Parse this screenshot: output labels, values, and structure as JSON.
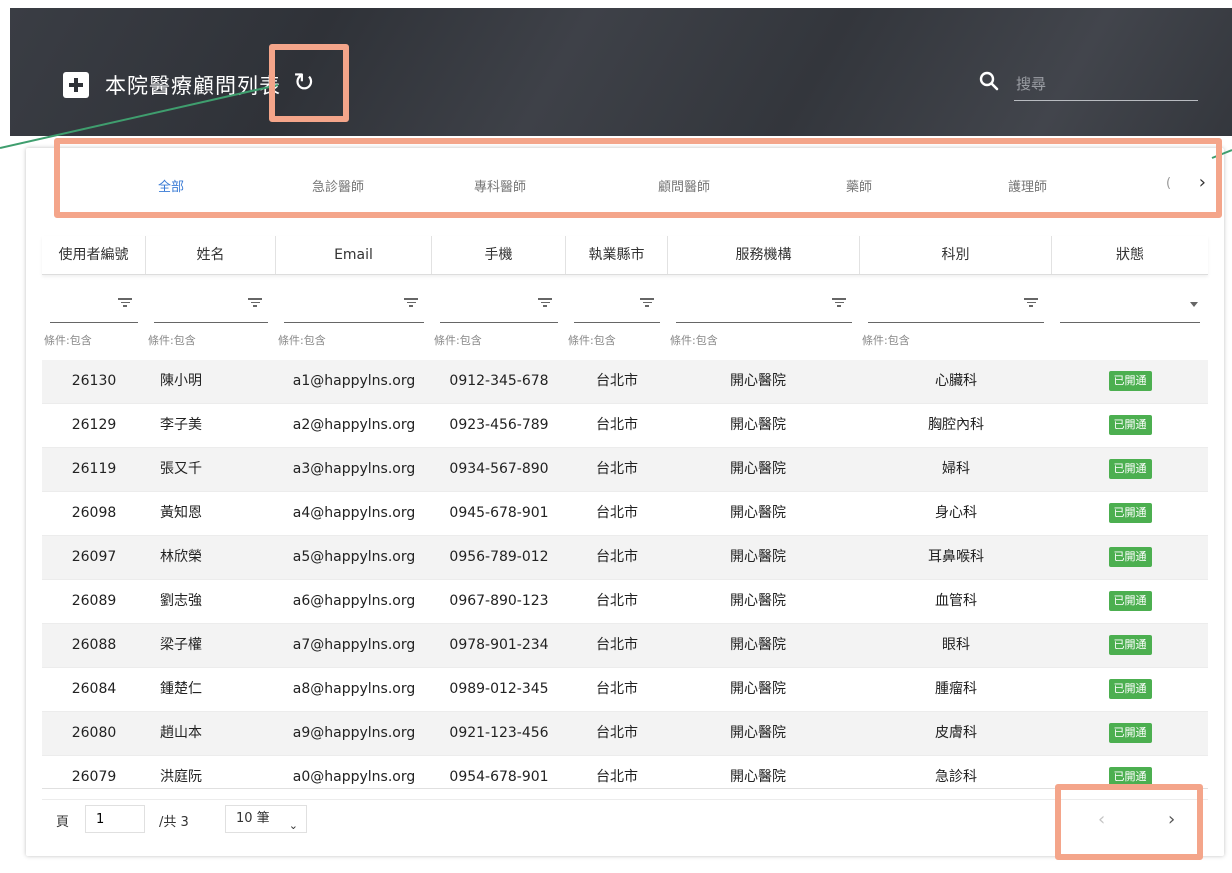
{
  "header": {
    "title": "本院醫療顧問列表",
    "refresh_icon": "↻",
    "search_placeholder": "搜尋"
  },
  "tabs": [
    {
      "label": "全部",
      "active": true
    },
    {
      "label": "急診醫師",
      "active": false
    },
    {
      "label": "專科醫師",
      "active": false
    },
    {
      "label": "顧問醫師",
      "active": false
    },
    {
      "label": "藥師",
      "active": false
    },
    {
      "label": "護理師",
      "active": false
    }
  ],
  "tab_fragment": "(",
  "tab_next_icon": "›",
  "columns": [
    "使用者編號",
    "姓名",
    "Email",
    "手機",
    "執業縣市",
    "服務機構",
    "科別",
    "狀態"
  ],
  "filter_condition": "條件:包含",
  "rows": [
    {
      "id": "26130",
      "name": "陳小明",
      "email": "a1@happylns.org",
      "phone": "0912-345-678",
      "city": "台北市",
      "org": "開心醫院",
      "dept": "心臟科",
      "status": "已開通"
    },
    {
      "id": "26129",
      "name": "李子美",
      "email": "a2@happylns.org",
      "phone": "0923-456-789",
      "city": "台北市",
      "org": "開心醫院",
      "dept": "胸腔內科",
      "status": "已開通"
    },
    {
      "id": "26119",
      "name": "張又千",
      "email": "a3@happylns.org",
      "phone": "0934-567-890",
      "city": "台北市",
      "org": "開心醫院",
      "dept": "婦科",
      "status": "已開通"
    },
    {
      "id": "26098",
      "name": "黃知恩",
      "email": "a4@happylns.org",
      "phone": "0945-678-901",
      "city": "台北市",
      "org": "開心醫院",
      "dept": "身心科",
      "status": "已開通"
    },
    {
      "id": "26097",
      "name": "林欣榮",
      "email": "a5@happylns.org",
      "phone": "0956-789-012",
      "city": "台北市",
      "org": "開心醫院",
      "dept": "耳鼻喉科",
      "status": "已開通"
    },
    {
      "id": "26089",
      "name": "劉志強",
      "email": "a6@happylns.org",
      "phone": "0967-890-123",
      "city": "台北市",
      "org": "開心醫院",
      "dept": "血管科",
      "status": "已開通"
    },
    {
      "id": "26088",
      "name": "梁子權",
      "email": "a7@happylns.org",
      "phone": "0978-901-234",
      "city": "台北市",
      "org": "開心醫院",
      "dept": "眼科",
      "status": "已開通"
    },
    {
      "id": "26084",
      "name": "鍾楚仁",
      "email": "a8@happylns.org",
      "phone": "0989-012-345",
      "city": "台北市",
      "org": "開心醫院",
      "dept": "腫瘤科",
      "status": "已開通"
    },
    {
      "id": "26080",
      "name": "趙山本",
      "email": "a9@happylns.org",
      "phone": "0921-123-456",
      "city": "台北市",
      "org": "開心醫院",
      "dept": "皮膚科",
      "status": "已開通"
    },
    {
      "id": "26079",
      "name": "洪庭阮",
      "email": "a0@happylns.org",
      "phone": "0954-678-901",
      "city": "台北市",
      "org": "開心醫院",
      "dept": "急診科",
      "status": "已開通"
    }
  ],
  "pagination": {
    "page_label": "頁",
    "current_page": "1",
    "total_label": "/共 3",
    "page_size": "10 筆",
    "prev_icon": "‹",
    "next_icon": "›"
  },
  "colors": {
    "header_bg": "#2f3238",
    "tab_active": "#3a7bd5",
    "status_badge": "#4caf50",
    "highlight": "#f4a58a",
    "annotation_line": "#3f9e6e"
  }
}
